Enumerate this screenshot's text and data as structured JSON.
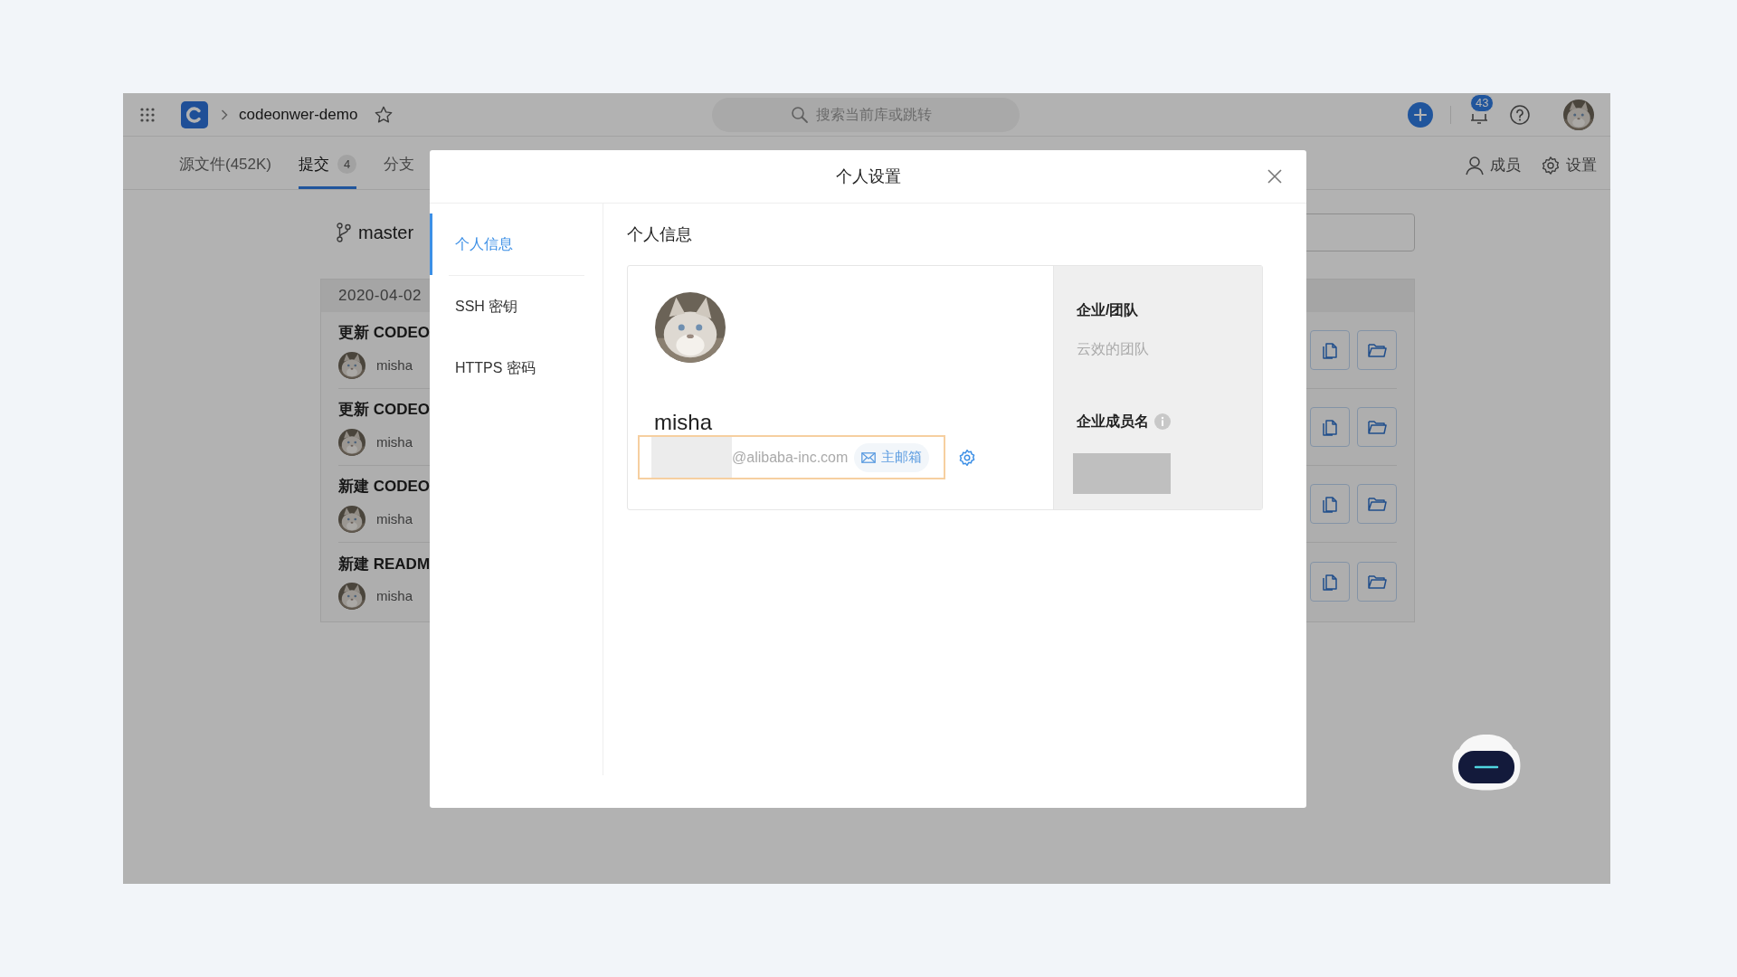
{
  "top_bar": {
    "project": "codeonwer-demo",
    "search": {
      "placeholder": "搜索当前库或跳转"
    },
    "notification_count": "43"
  },
  "repo_tabs": [
    {
      "label": "源文件(452K)",
      "selected": false
    },
    {
      "label": "提交",
      "count": "4",
      "selected": true
    },
    {
      "label": "分支",
      "selected": false
    }
  ],
  "repo_actions": [
    {
      "label": "成员",
      "kind": "members"
    },
    {
      "label": "设置",
      "kind": "settings"
    }
  ],
  "branch": "master",
  "commits": {
    "date": "2020-04-02",
    "rows": [
      {
        "title": "更新 CODEO",
        "author": "misha"
      },
      {
        "title": "更新 CODEO",
        "author": "misha"
      },
      {
        "title": "新建 CODEO",
        "author": "misha"
      },
      {
        "title": "新建 READM",
        "author": "misha"
      }
    ]
  },
  "dialog": {
    "title": "个人设置",
    "nav": [
      {
        "label": "个人信息",
        "selected": true
      },
      {
        "label": "SSH 密钥",
        "selected": false
      },
      {
        "label": "HTTPS 密码",
        "selected": false
      }
    ],
    "section_title": "个人信息",
    "profile": {
      "name": "misha",
      "email_domain": "@alibaba-inc.com",
      "email_tag": "主邮箱",
      "team_label": "企业/团队",
      "team": "云效的团队",
      "member_name_label": "企业成员名"
    }
  }
}
